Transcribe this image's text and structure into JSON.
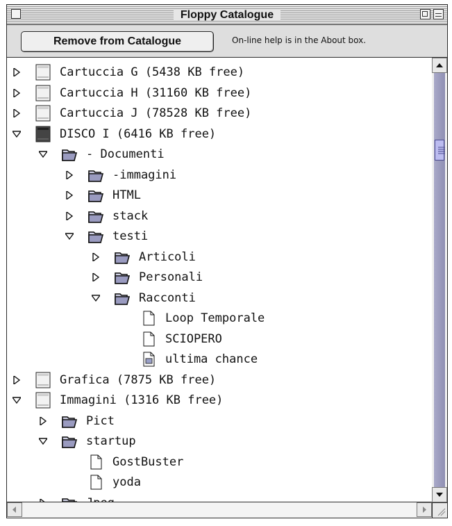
{
  "window": {
    "title": "Floppy Catalogue"
  },
  "toolbar": {
    "remove_label": "Remove from Catalogue",
    "help_text": "On-line help is in the About box."
  },
  "tree": [
    {
      "label": "Cartuccia G (5438 KB free)",
      "level": 0,
      "icon": "disk-icon",
      "expanded": false
    },
    {
      "label": "Cartuccia H (31160 KB free)",
      "level": 0,
      "icon": "disk-icon",
      "expanded": false
    },
    {
      "label": "Cartuccia J (78528 KB free)",
      "level": 0,
      "icon": "disk-icon",
      "expanded": false
    },
    {
      "label": "DISCO I (6416 KB free)",
      "level": 0,
      "icon": "disk-dark-icon",
      "expanded": true
    },
    {
      "label": "- Documenti",
      "level": 1,
      "icon": "folder-icon",
      "expanded": true
    },
    {
      "label": "-immagini",
      "level": 2,
      "icon": "folder-icon",
      "expanded": false
    },
    {
      "label": "HTML",
      "level": 2,
      "icon": "folder-icon",
      "expanded": false
    },
    {
      "label": "stack",
      "level": 2,
      "icon": "folder-icon",
      "expanded": false
    },
    {
      "label": "testi",
      "level": 2,
      "icon": "folder-icon",
      "expanded": true
    },
    {
      "label": "Articoli",
      "level": 3,
      "icon": "folder-icon",
      "expanded": false
    },
    {
      "label": "Personali",
      "level": 3,
      "icon": "folder-icon",
      "expanded": false
    },
    {
      "label": "Racconti",
      "level": 3,
      "icon": "folder-icon",
      "expanded": true
    },
    {
      "label": "Loop Temporale",
      "level": 4,
      "icon": "document-icon",
      "expanded": null
    },
    {
      "label": "SCIOPERO",
      "level": 4,
      "icon": "document-icon",
      "expanded": null
    },
    {
      "label": "ultima chance",
      "level": 4,
      "icon": "document-image-icon",
      "expanded": null
    },
    {
      "label": "Grafica (7875 KB free)",
      "level": 0,
      "icon": "disk-icon",
      "expanded": false
    },
    {
      "label": "Immagini (1316 KB free)",
      "level": 0,
      "icon": "disk-icon",
      "expanded": true
    },
    {
      "label": "Pict",
      "level": 1,
      "icon": "folder-icon",
      "expanded": false
    },
    {
      "label": "startup",
      "level": 1,
      "icon": "folder-icon",
      "expanded": true
    },
    {
      "label": "GostBuster",
      "level": 2,
      "icon": "document-icon",
      "expanded": null
    },
    {
      "label": "yoda",
      "level": 2,
      "icon": "document-icon",
      "expanded": null
    },
    {
      "label": "Jpeg",
      "level": 1,
      "icon": "folder-icon",
      "expanded": false
    }
  ],
  "scrollbar": {
    "vertical_position": 0.17
  },
  "colors": {
    "window_bg": "#dcdcdc",
    "list_bg": "#ffffff",
    "scroll_track": "#9d9dbf",
    "scroll_thumb": "#bcbcf0"
  }
}
